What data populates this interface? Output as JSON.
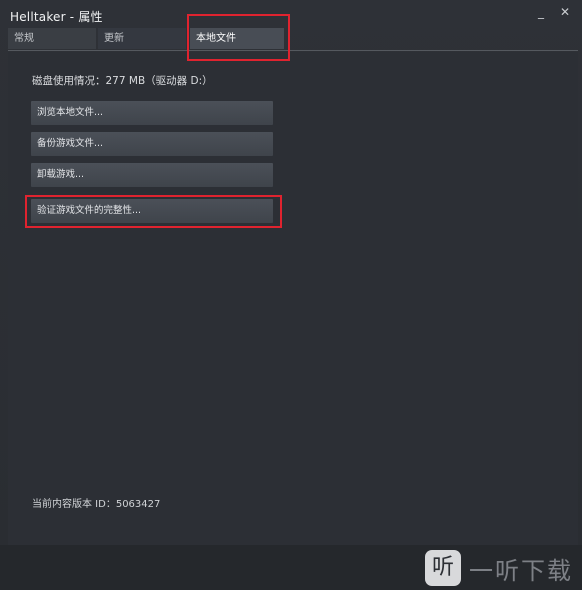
{
  "window": {
    "title": "Helltaker - 属性",
    "minimize_glyph": "_",
    "close_glyph": "✕"
  },
  "tabs": [
    {
      "label": "常规"
    },
    {
      "label": "更新"
    },
    {
      "label": "本地文件",
      "active": true
    }
  ],
  "local_files": {
    "disk_usage": "磁盘使用情况：277 MB（驱动器 D:）",
    "buttons": {
      "browse": "浏览本地文件...",
      "backup": "备份游戏文件...",
      "uninstall": "卸载游戏...",
      "verify": "验证游戏文件的完整性..."
    },
    "version": "当前内容版本 ID：5063427"
  },
  "watermark": {
    "logo_glyph": "听",
    "text": "一听下载"
  },
  "colors": {
    "highlight": "#e0232f",
    "background": "#2b2e33",
    "button": "#464b52"
  }
}
